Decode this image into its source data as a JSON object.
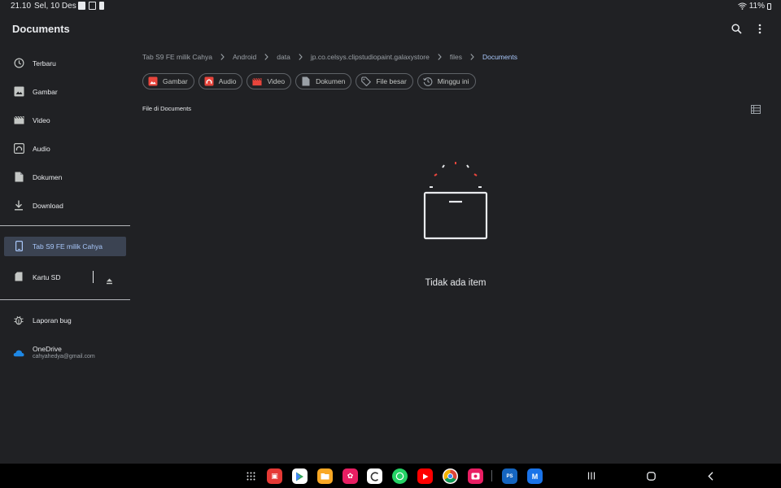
{
  "status": {
    "time": "21.10",
    "date": "Sel, 10 Des",
    "battery": "11%"
  },
  "app": {
    "title": "Documents"
  },
  "sidebar": {
    "items": [
      {
        "label": "Terbaru",
        "icon": "clock-icon"
      },
      {
        "label": "Gambar",
        "icon": "image-icon"
      },
      {
        "label": "Video",
        "icon": "video-icon"
      },
      {
        "label": "Audio",
        "icon": "audio-icon"
      },
      {
        "label": "Dokumen",
        "icon": "document-icon"
      },
      {
        "label": "Download",
        "icon": "download-icon"
      }
    ],
    "storage": [
      {
        "label": "Tab S9 FE milik Cahya",
        "icon": "tablet-icon",
        "active": true
      },
      {
        "label": "Kartu SD",
        "icon": "sd-card-icon"
      }
    ],
    "bug_report": "Laporan bug",
    "onedrive": {
      "label": "OneDrive",
      "email": "cahyahedya@gmail.com"
    }
  },
  "breadcrumb": [
    "Tab S9 FE milik Cahya",
    "Android",
    "data",
    "jp.co.celsys.clipstudiopaint.galaxystore",
    "files",
    "Documents"
  ],
  "chips": [
    {
      "label": "Gambar",
      "icon": "image-icon"
    },
    {
      "label": "Audio",
      "icon": "audio-icon"
    },
    {
      "label": "Video",
      "icon": "video-icon"
    },
    {
      "label": "Dokumen",
      "icon": "document-icon"
    },
    {
      "label": "File besar",
      "icon": "tag-icon"
    },
    {
      "label": "Minggu ini",
      "icon": "history-icon"
    }
  ],
  "section_label": "File di Documents",
  "empty_state": "Tidak ada item",
  "colors": {
    "accent": "#a8c7fa",
    "background": "#202124",
    "active_bg": "#3b4352",
    "chip_icon": "#e8453c"
  }
}
